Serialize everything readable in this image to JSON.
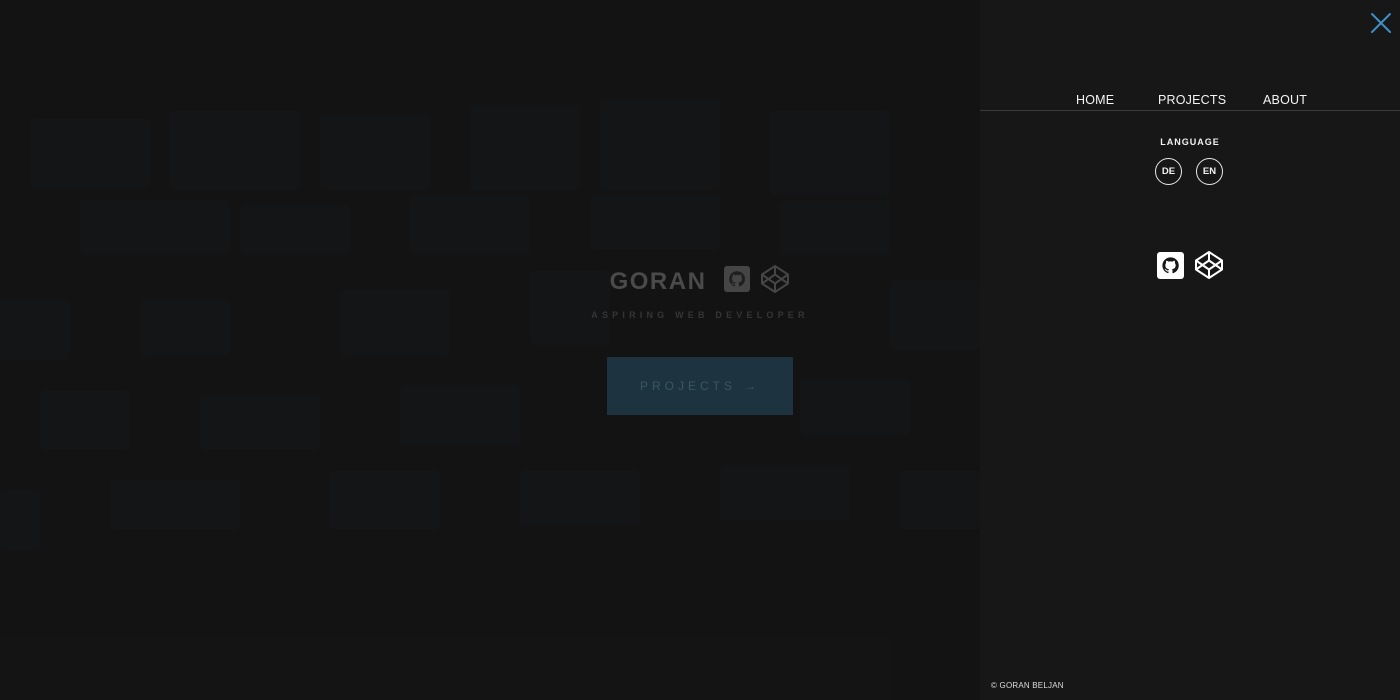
{
  "hero": {
    "name": "GORAN",
    "tagline": "ASPIRING WEB DEVELOPER",
    "projects_button": "PROJECTS",
    "projects_arrow": "→",
    "icons": [
      "github-icon",
      "codepen-icon"
    ]
  },
  "panel": {
    "close_icon": "close-icon",
    "nav": [
      {
        "label": "HOME"
      },
      {
        "label": "PROJECTS"
      },
      {
        "label": "ABOUT"
      }
    ],
    "language_label": "LANGUAGE",
    "languages": [
      {
        "label": "DE"
      },
      {
        "label": "EN"
      }
    ],
    "social_icons": [
      "github-icon",
      "codepen-icon"
    ],
    "copyright": "© GORAN BELJAN"
  },
  "colors": {
    "accent": "#3d8fc8",
    "panel_bg": "#171717",
    "text": "#f4f4f4"
  }
}
